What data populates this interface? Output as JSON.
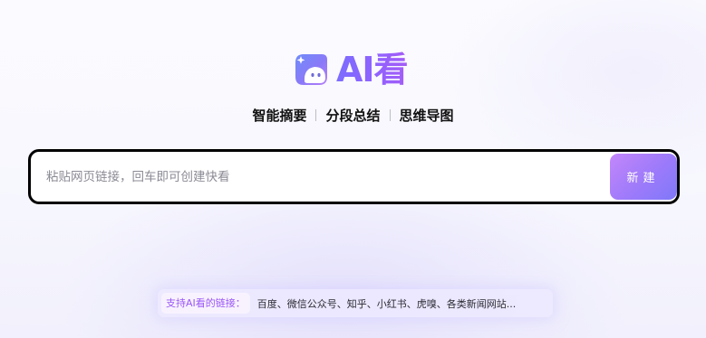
{
  "logo": {
    "text": "AI看",
    "icon": "ghost-chat-bubble-icon",
    "colors": {
      "start": "#7b78f8",
      "end": "#b57ef9"
    }
  },
  "features": [
    "智能摘要",
    "分段总结",
    "思维导图"
  ],
  "search": {
    "placeholder": "粘贴网页链接，回车即可创建快看",
    "value": "",
    "button_label": "新建"
  },
  "support": {
    "label": "支持AI看的链接：",
    "sites": "百度、微信公众号、知乎、小红书、虎嗅、各类新闻网站..."
  },
  "colors": {
    "accent": "#9a57f5",
    "button_gradient_start": "#c387fb",
    "button_gradient_end": "#7f78f9",
    "border": "#000000"
  }
}
